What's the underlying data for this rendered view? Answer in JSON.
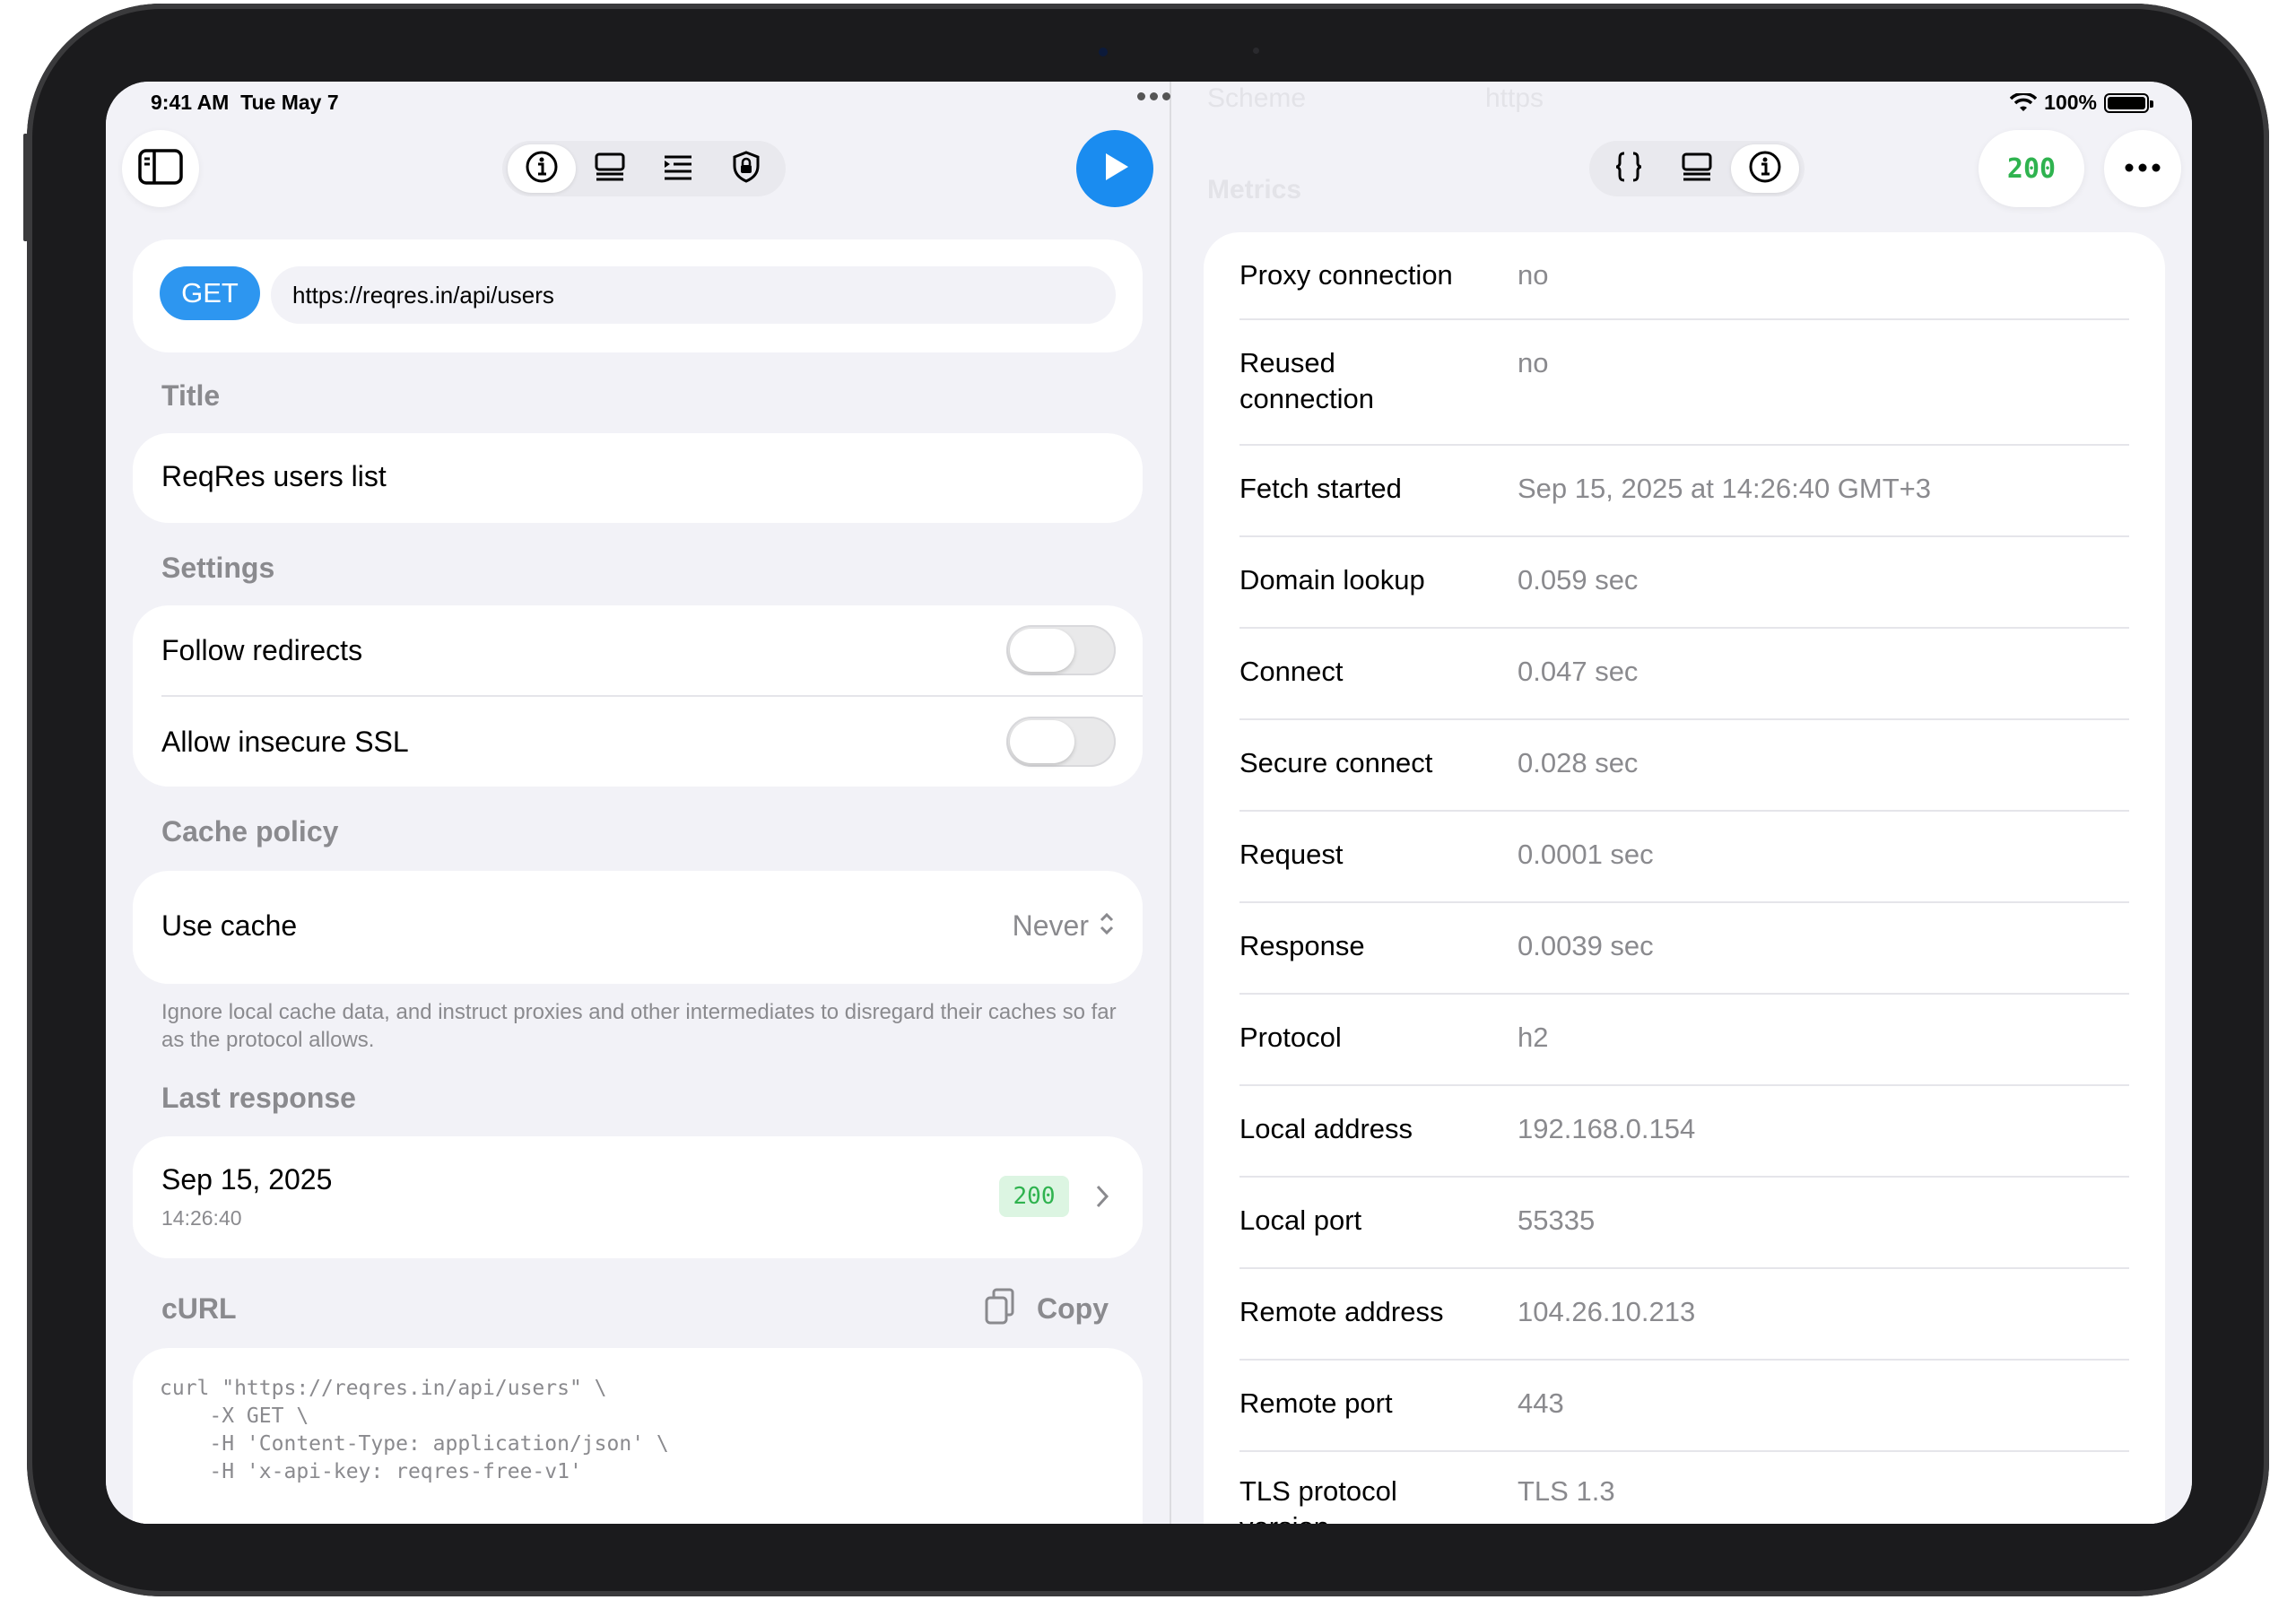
{
  "status_bar": {
    "time": "9:41 AM  Tue May 7",
    "battery": "100%"
  },
  "request": {
    "method": "GET",
    "url": "https://reqres.in/api/users"
  },
  "sections": {
    "title_label": "Title",
    "title_value": "ReqRes users list",
    "settings_label": "Settings",
    "follow_redirects": "Follow redirects",
    "allow_insecure_ssl": "Allow insecure SSL",
    "cache_policy_label": "Cache policy",
    "use_cache": "Use cache",
    "use_cache_value": "Never",
    "cache_footnote": "Ignore local cache data, and instruct proxies and other intermediates to disregard their caches so far as the protocol allows.",
    "last_response_label": "Last response",
    "last_response_date": "Sep 15, 2025",
    "last_response_time": "14:26:40",
    "last_response_status": "200",
    "curl_label": "cURL",
    "copy_label": "Copy",
    "curl_code": "curl \"https://reqres.in/api/users\" \\\n    -X GET \\\n    -H 'Content-Type: application/json' \\\n    -H 'x-api-key: reqres-free-v1'"
  },
  "right": {
    "status_badge": "200",
    "faded_scheme_label": "Scheme",
    "faded_scheme_value": "https",
    "faded_metrics_label": "Metrics",
    "metrics": [
      {
        "label": "Proxy connection",
        "value": "no"
      },
      {
        "label": "Reused\nconnection",
        "value": "no"
      },
      {
        "label": "Fetch started",
        "value": "Sep 15, 2025 at 14:26:40 GMT+3"
      },
      {
        "label": "Domain lookup",
        "value": "0.059 sec"
      },
      {
        "label": "Connect",
        "value": "0.047 sec"
      },
      {
        "label": "Secure connect",
        "value": "0.028 sec"
      },
      {
        "label": "Request",
        "value": "0.0001 sec"
      },
      {
        "label": "Response",
        "value": "0.0039 sec"
      },
      {
        "label": "Protocol",
        "value": "h2"
      },
      {
        "label": "Local address",
        "value": "192.168.0.154"
      },
      {
        "label": "Local port",
        "value": "55335"
      },
      {
        "label": "Remote address",
        "value": "104.26.10.213"
      },
      {
        "label": "Remote port",
        "value": "443"
      },
      {
        "label": "TLS protocol\nversion",
        "value": "TLS 1.3"
      }
    ]
  },
  "colors": {
    "accent": "#1a8cf0",
    "success": "#2fb34f",
    "secondary_text": "#8a8a8e"
  }
}
